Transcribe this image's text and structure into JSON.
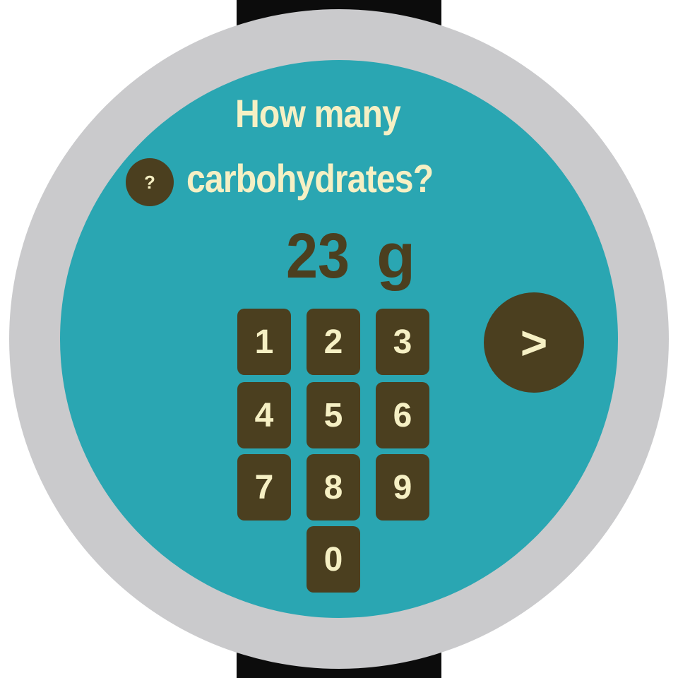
{
  "colors": {
    "background": "#ffffff",
    "strap": "#0c0c0c",
    "bezel": "#cacacc",
    "face": "#2aa6b2",
    "accent_dark": "#4b3f1f",
    "text_light": "#f6f0c4"
  },
  "question": {
    "line1": "How many",
    "line2": "carbohydrates?"
  },
  "help_button": {
    "label": "?",
    "icon": "help-icon"
  },
  "entry": {
    "value": "23",
    "unit": "g"
  },
  "keypad": {
    "keys": [
      "1",
      "2",
      "3",
      "4",
      "5",
      "6",
      "7",
      "8",
      "9",
      "0"
    ]
  },
  "next_button": {
    "label": ">",
    "icon": "chevron-right-icon"
  }
}
